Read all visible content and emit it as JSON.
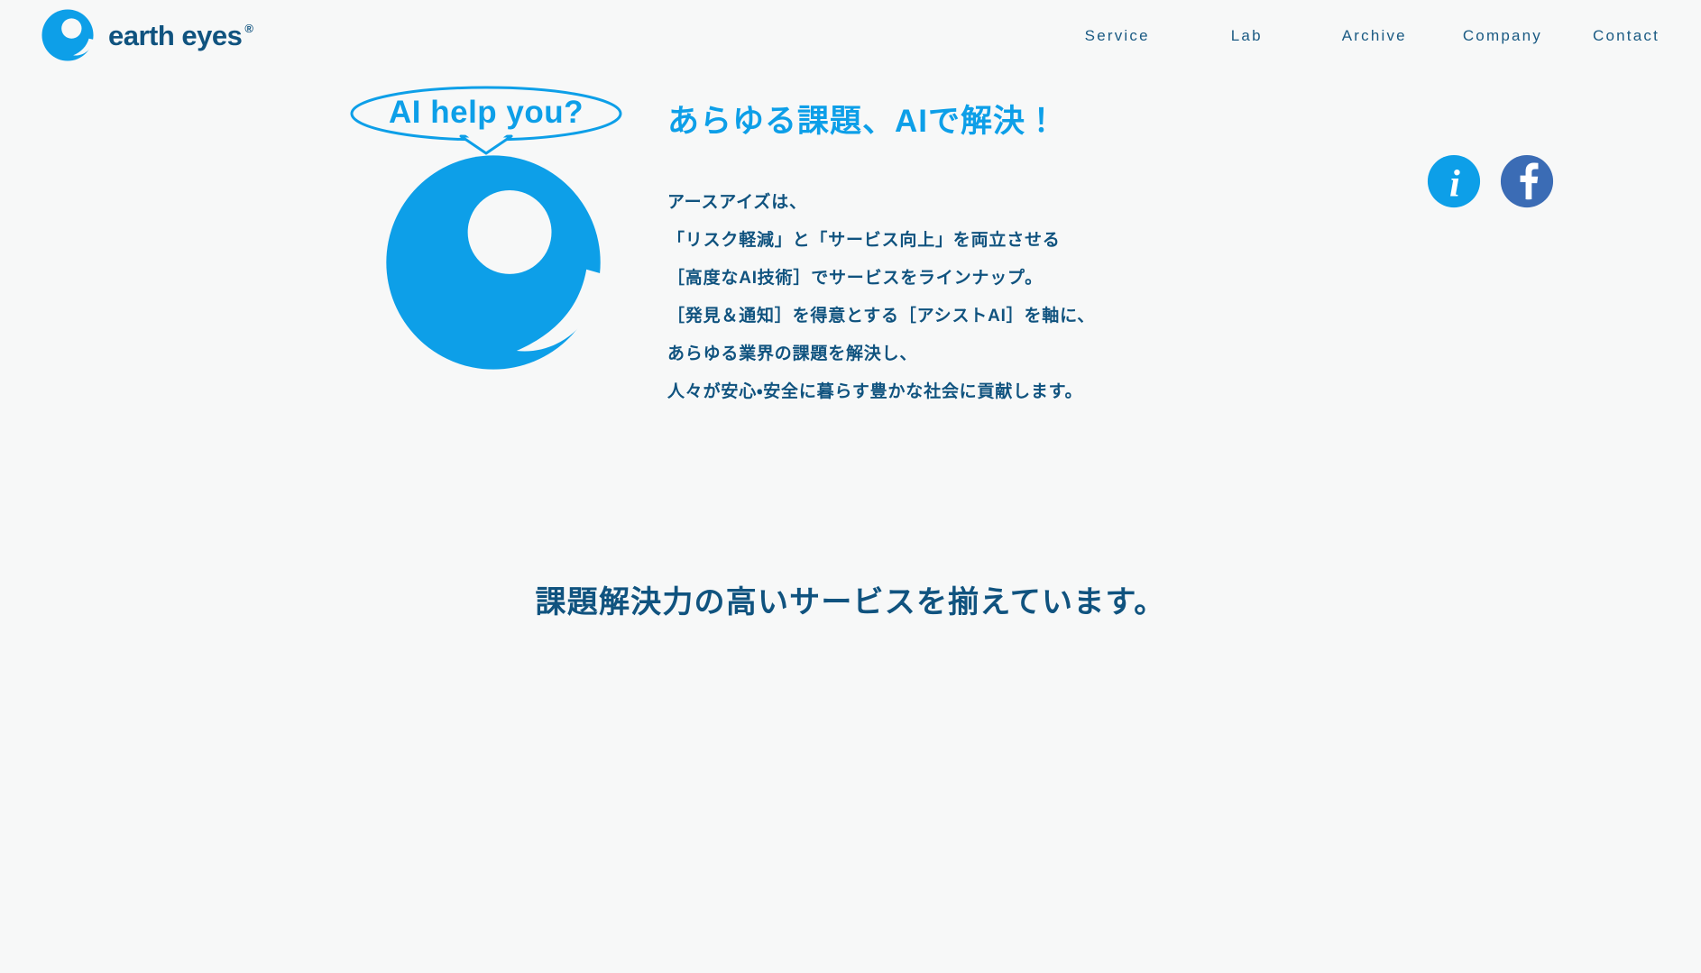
{
  "site": {
    "background_color": "#f7f8f8",
    "brand_primary": "#0d9fe8",
    "brand_dark": "#10537f",
    "facebook_color": "#3b6cb5"
  },
  "header": {
    "logo": {
      "name": "earth eyes",
      "registered_mark": "®",
      "icon": "earth-eyes-logo-mark"
    },
    "nav": [
      {
        "label": "Service"
      },
      {
        "label": "Lab"
      },
      {
        "label": "Archive"
      },
      {
        "label": "Company"
      },
      {
        "label": "Contact"
      }
    ]
  },
  "hero": {
    "speech_bubble": "AI help you?",
    "mark_icon": "earth-eyes-hero-mark",
    "headline": "あらゆる課題、AIで解決！",
    "body_lines": [
      "アースアイズは、",
      "「リスク軽減」と「サービス向上」を両立させる",
      "［高度なAI技術］でサービスをラインナップ。",
      "［発見＆通知］を得意とする［アシストAI］を軸に、",
      "あらゆる業界の課題を解決し、",
      "人々が安心・安全に暮らす豊かな社会に貢献します。"
    ],
    "social": [
      {
        "name": "info-icon",
        "glyph": "i",
        "color": "#0d9fe8"
      },
      {
        "name": "facebook-icon",
        "glyph": "f",
        "color": "#3b6cb5"
      }
    ]
  },
  "section": {
    "heading": "課題解決力の高いサービスを揃えています。"
  }
}
